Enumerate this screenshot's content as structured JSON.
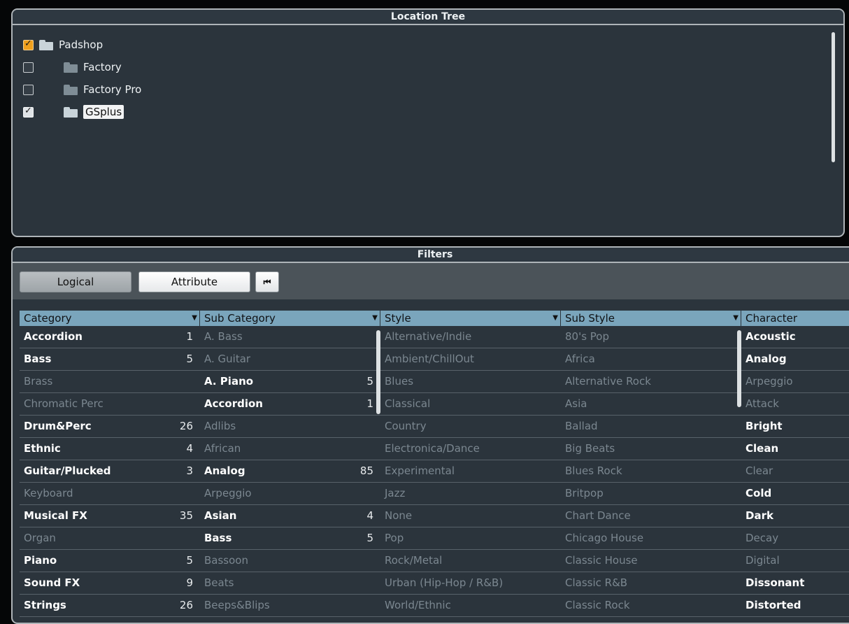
{
  "location_tree": {
    "title": "Location Tree",
    "items": [
      {
        "label": "Padshop",
        "checked": true,
        "level": 0
      },
      {
        "label": "Factory",
        "checked": false,
        "level": 1
      },
      {
        "label": "Factory Pro",
        "checked": false,
        "level": 1
      },
      {
        "label": "GSplus",
        "checked": true,
        "level": 1,
        "selected": true
      }
    ]
  },
  "filters": {
    "title": "Filters",
    "buttons": {
      "logical": "Logical",
      "attribute": "Attribute",
      "rewind": "⏮"
    },
    "columns": [
      {
        "header": "Category",
        "rows": [
          {
            "label": "Accordion",
            "count": "1",
            "active": true
          },
          {
            "label": "Bass",
            "count": "5",
            "active": true
          },
          {
            "label": "Brass",
            "count": "",
            "active": false
          },
          {
            "label": "Chromatic Perc",
            "count": "",
            "active": false
          },
          {
            "label": "Drum&Perc",
            "count": "26",
            "active": true
          },
          {
            "label": "Ethnic",
            "count": "4",
            "active": true
          },
          {
            "label": "Guitar/Plucked",
            "count": "3",
            "active": true
          },
          {
            "label": "Keyboard",
            "count": "",
            "active": false
          },
          {
            "label": "Musical FX",
            "count": "35",
            "active": true
          },
          {
            "label": "Organ",
            "count": "",
            "active": false
          },
          {
            "label": "Piano",
            "count": "5",
            "active": true
          },
          {
            "label": "Sound FX",
            "count": "9",
            "active": true
          },
          {
            "label": "Strings",
            "count": "26",
            "active": true
          }
        ]
      },
      {
        "header": "Sub Category",
        "rows": [
          {
            "label": "A. Bass",
            "count": "",
            "active": false
          },
          {
            "label": "A. Guitar",
            "count": "",
            "active": false
          },
          {
            "label": "A. Piano",
            "count": "5",
            "active": true
          },
          {
            "label": "Accordion",
            "count": "1",
            "active": true
          },
          {
            "label": "Adlibs",
            "count": "",
            "active": false
          },
          {
            "label": "African",
            "count": "",
            "active": false
          },
          {
            "label": "Analog",
            "count": "85",
            "active": true
          },
          {
            "label": "Arpeggio",
            "count": "",
            "active": false
          },
          {
            "label": "Asian",
            "count": "4",
            "active": true
          },
          {
            "label": "Bass",
            "count": "5",
            "active": true
          },
          {
            "label": "Bassoon",
            "count": "",
            "active": false
          },
          {
            "label": "Beats",
            "count": "",
            "active": false
          },
          {
            "label": "Beeps&Blips",
            "count": "",
            "active": false
          }
        ]
      },
      {
        "header": "Style",
        "rows": [
          {
            "label": "Alternative/Indie",
            "count": "",
            "active": false
          },
          {
            "label": "Ambient/ChillOut",
            "count": "",
            "active": false
          },
          {
            "label": "Blues",
            "count": "",
            "active": false
          },
          {
            "label": "Classical",
            "count": "",
            "active": false
          },
          {
            "label": "Country",
            "count": "",
            "active": false
          },
          {
            "label": "Electronica/Dance",
            "count": "",
            "active": false
          },
          {
            "label": "Experimental",
            "count": "",
            "active": false
          },
          {
            "label": "Jazz",
            "count": "",
            "active": false
          },
          {
            "label": "None",
            "count": "",
            "active": false
          },
          {
            "label": "Pop",
            "count": "",
            "active": false
          },
          {
            "label": "Rock/Metal",
            "count": "",
            "active": false
          },
          {
            "label": "Urban (Hip-Hop / R&B)",
            "count": "",
            "active": false
          },
          {
            "label": "World/Ethnic",
            "count": "",
            "active": false
          }
        ]
      },
      {
        "header": "Sub Style",
        "rows": [
          {
            "label": "80's Pop",
            "count": "",
            "active": false
          },
          {
            "label": "Africa",
            "count": "",
            "active": false
          },
          {
            "label": "Alternative Rock",
            "count": "",
            "active": false
          },
          {
            "label": "Asia",
            "count": "",
            "active": false
          },
          {
            "label": "Ballad",
            "count": "",
            "active": false
          },
          {
            "label": "Big Beats",
            "count": "",
            "active": false
          },
          {
            "label": "Blues Rock",
            "count": "",
            "active": false
          },
          {
            "label": "Britpop",
            "count": "",
            "active": false
          },
          {
            "label": "Chart Dance",
            "count": "",
            "active": false
          },
          {
            "label": "Chicago House",
            "count": "",
            "active": false
          },
          {
            "label": "Classic House",
            "count": "",
            "active": false
          },
          {
            "label": "Classic R&B",
            "count": "",
            "active": false
          },
          {
            "label": "Classic Rock",
            "count": "",
            "active": false
          }
        ]
      },
      {
        "header": "Character",
        "rows": [
          {
            "label": "Acoustic",
            "count": "",
            "active": true
          },
          {
            "label": "Analog",
            "count": "",
            "active": true
          },
          {
            "label": "Arpeggio",
            "count": "",
            "active": false
          },
          {
            "label": "Attack",
            "count": "",
            "active": false
          },
          {
            "label": "Bright",
            "count": "",
            "active": true
          },
          {
            "label": "Clean",
            "count": "",
            "active": true
          },
          {
            "label": "Clear",
            "count": "",
            "active": false
          },
          {
            "label": "Cold",
            "count": "",
            "active": true
          },
          {
            "label": "Dark",
            "count": "",
            "active": true
          },
          {
            "label": "Decay",
            "count": "",
            "active": false
          },
          {
            "label": "Digital",
            "count": "",
            "active": false
          },
          {
            "label": "Dissonant",
            "count": "",
            "active": true
          },
          {
            "label": "Distorted",
            "count": "",
            "active": true
          }
        ]
      }
    ]
  },
  "colors": {
    "panel_bg": "#2b343c",
    "header_blue": "#7aa5bc",
    "accent_orange": "#f0a01c"
  }
}
